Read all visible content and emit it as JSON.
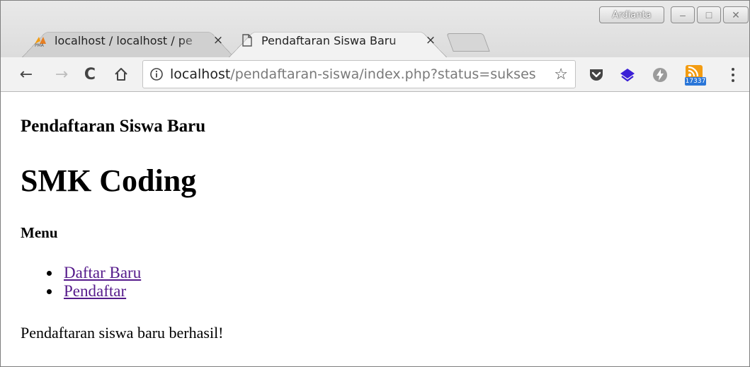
{
  "browser": {
    "profile_name": "Ardianta",
    "tabs": [
      {
        "title": "localhost / localhost / pe",
        "favicon": "phpmyadmin-icon",
        "close": "×",
        "active": false
      },
      {
        "title": "Pendaftaran Siswa Baru",
        "favicon": "page-icon",
        "close": "×",
        "active": true
      }
    ],
    "window_controls": {
      "minimize": "–",
      "maximize": "□",
      "close": "✕"
    },
    "toolbar": {
      "back": "←",
      "forward": "→",
      "reload": "C",
      "home": "⌂",
      "url_host": "localhost",
      "url_path": "/pendaftaran-siswa/index.php?status=sukses",
      "bookmark": "☆",
      "extensions": [
        "pocket-icon",
        "layers-icon",
        "bolt-icon",
        "rss-icon"
      ],
      "rss_badge": "17337"
    }
  },
  "page": {
    "heading_small": "Pendaftaran Siswa Baru",
    "heading_large": "SMK Coding",
    "menu_title": "Menu",
    "menu_items": [
      {
        "label": "Daftar Baru"
      },
      {
        "label": "Pendaftar"
      }
    ],
    "message": "Pendaftaran siswa baru berhasil!"
  },
  "colors": {
    "visited_link": "#551a8b",
    "toolbar_bg": "#f2f2f2",
    "rss_orange": "#f39c12",
    "badge_blue": "#2a76d8",
    "layers_purple": "#3b1fd6"
  }
}
